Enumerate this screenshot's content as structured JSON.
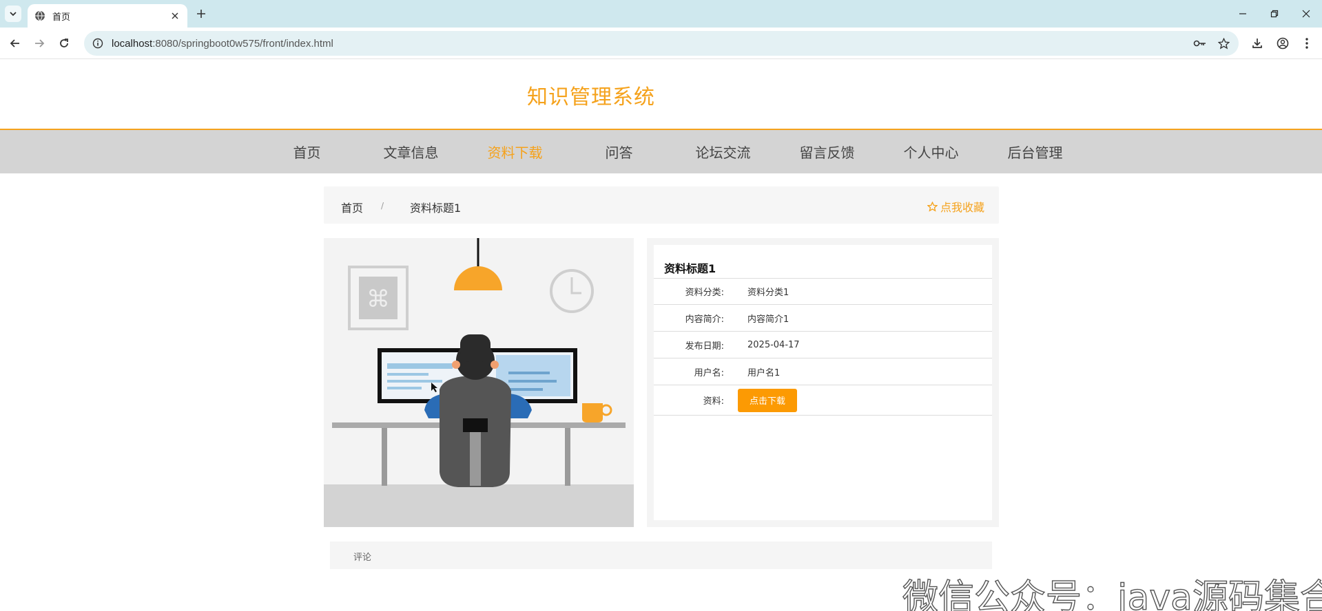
{
  "browser": {
    "tab_title": "首页",
    "url_host": "localhost",
    "url_rest": ":8080/springboot0w575/front/index.html"
  },
  "site": {
    "title": "知识管理系统",
    "accent_color": "#f5a21c"
  },
  "nav": {
    "items": [
      {
        "label": "首页"
      },
      {
        "label": "文章信息"
      },
      {
        "label": "资料下载",
        "active": true
      },
      {
        "label": "问答"
      },
      {
        "label": "论坛交流"
      },
      {
        "label": "留言反馈"
      },
      {
        "label": "个人中心"
      },
      {
        "label": "后台管理"
      }
    ]
  },
  "breadcrumb": {
    "home": "首页",
    "separator": "/",
    "current": "资料标题1",
    "favorite": "点我收藏"
  },
  "detail": {
    "title": "资料标题1",
    "rows": [
      {
        "label": "资料分类:",
        "value": "资料分类1"
      },
      {
        "label": "内容简介:",
        "value": "内容简介1"
      },
      {
        "label": "发布日期:",
        "value": "2025-04-17"
      },
      {
        "label": "用户名:",
        "value": "用户名1"
      }
    ],
    "file_label": "资料:",
    "download_button": "点击下载"
  },
  "comment": {
    "label": "评论"
  },
  "watermark": "微信公众号：java源码集合"
}
